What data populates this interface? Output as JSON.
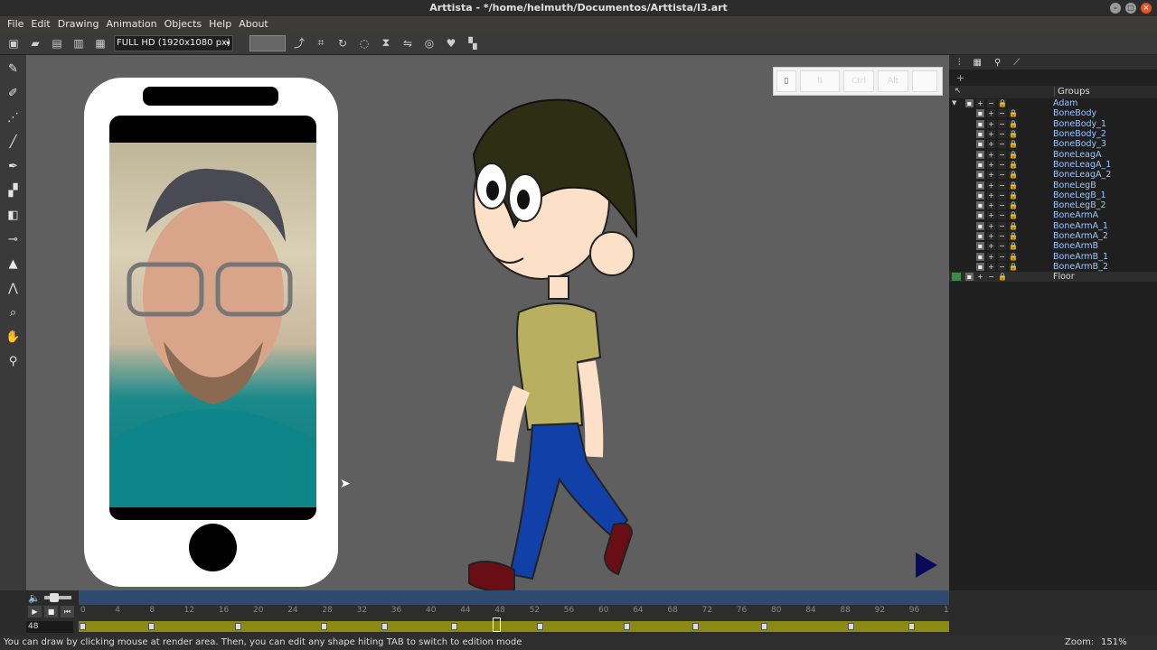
{
  "window": {
    "title": "Arttista - */home/helmuth/Documentos/Arttista/l3.art"
  },
  "menu": [
    "File",
    "Edit",
    "Drawing",
    "Animation",
    "Objects",
    "Help",
    "About"
  ],
  "toolbar": {
    "resolution": "FULL HD (1920x1080 px)"
  },
  "key_overlay": {
    "ctrl": "Ctrl",
    "alt": "Alt"
  },
  "panel": {
    "groups_label": "Groups"
  },
  "layers": [
    {
      "name": "Adam",
      "level": 0
    },
    {
      "name": "BoneBody",
      "level": 1
    },
    {
      "name": "BoneBody_1",
      "level": 1
    },
    {
      "name": "BoneBody_2",
      "level": 1
    },
    {
      "name": "BoneBody_3",
      "level": 1
    },
    {
      "name": "BoneLeagA",
      "level": 1
    },
    {
      "name": "BoneLeagA_1",
      "level": 1
    },
    {
      "name": "BoneLeagA_2",
      "level": 1
    },
    {
      "name": "BoneLegB",
      "level": 1
    },
    {
      "name": "BoneLegB_1",
      "level": 1
    },
    {
      "name": "BoneLegB_2",
      "level": 1
    },
    {
      "name": "BoneArmA",
      "level": 1
    },
    {
      "name": "BoneArmA_1",
      "level": 1
    },
    {
      "name": "BoneArmA_2",
      "level": 1
    },
    {
      "name": "BoneArmB",
      "level": 1
    },
    {
      "name": "BoneArmB_1",
      "level": 1
    },
    {
      "name": "BoneArmB_2",
      "level": 1
    },
    {
      "name": "Floor",
      "level": 0
    }
  ],
  "timeline": {
    "current_frame": "48",
    "ticks": [
      "0",
      "4",
      "8",
      "12",
      "16",
      "20",
      "24",
      "28",
      "32",
      "36",
      "40",
      "44",
      "48",
      "52",
      "56",
      "60",
      "64",
      "68",
      "72",
      "76",
      "80",
      "84",
      "88",
      "92",
      "96",
      "1"
    ]
  },
  "status": {
    "message": "You can draw by clicking mouse at render area. Then, you can edit any shape hiting TAB to switch to edition mode",
    "zoom_label": "Zoom:",
    "zoom_value": "151%"
  }
}
